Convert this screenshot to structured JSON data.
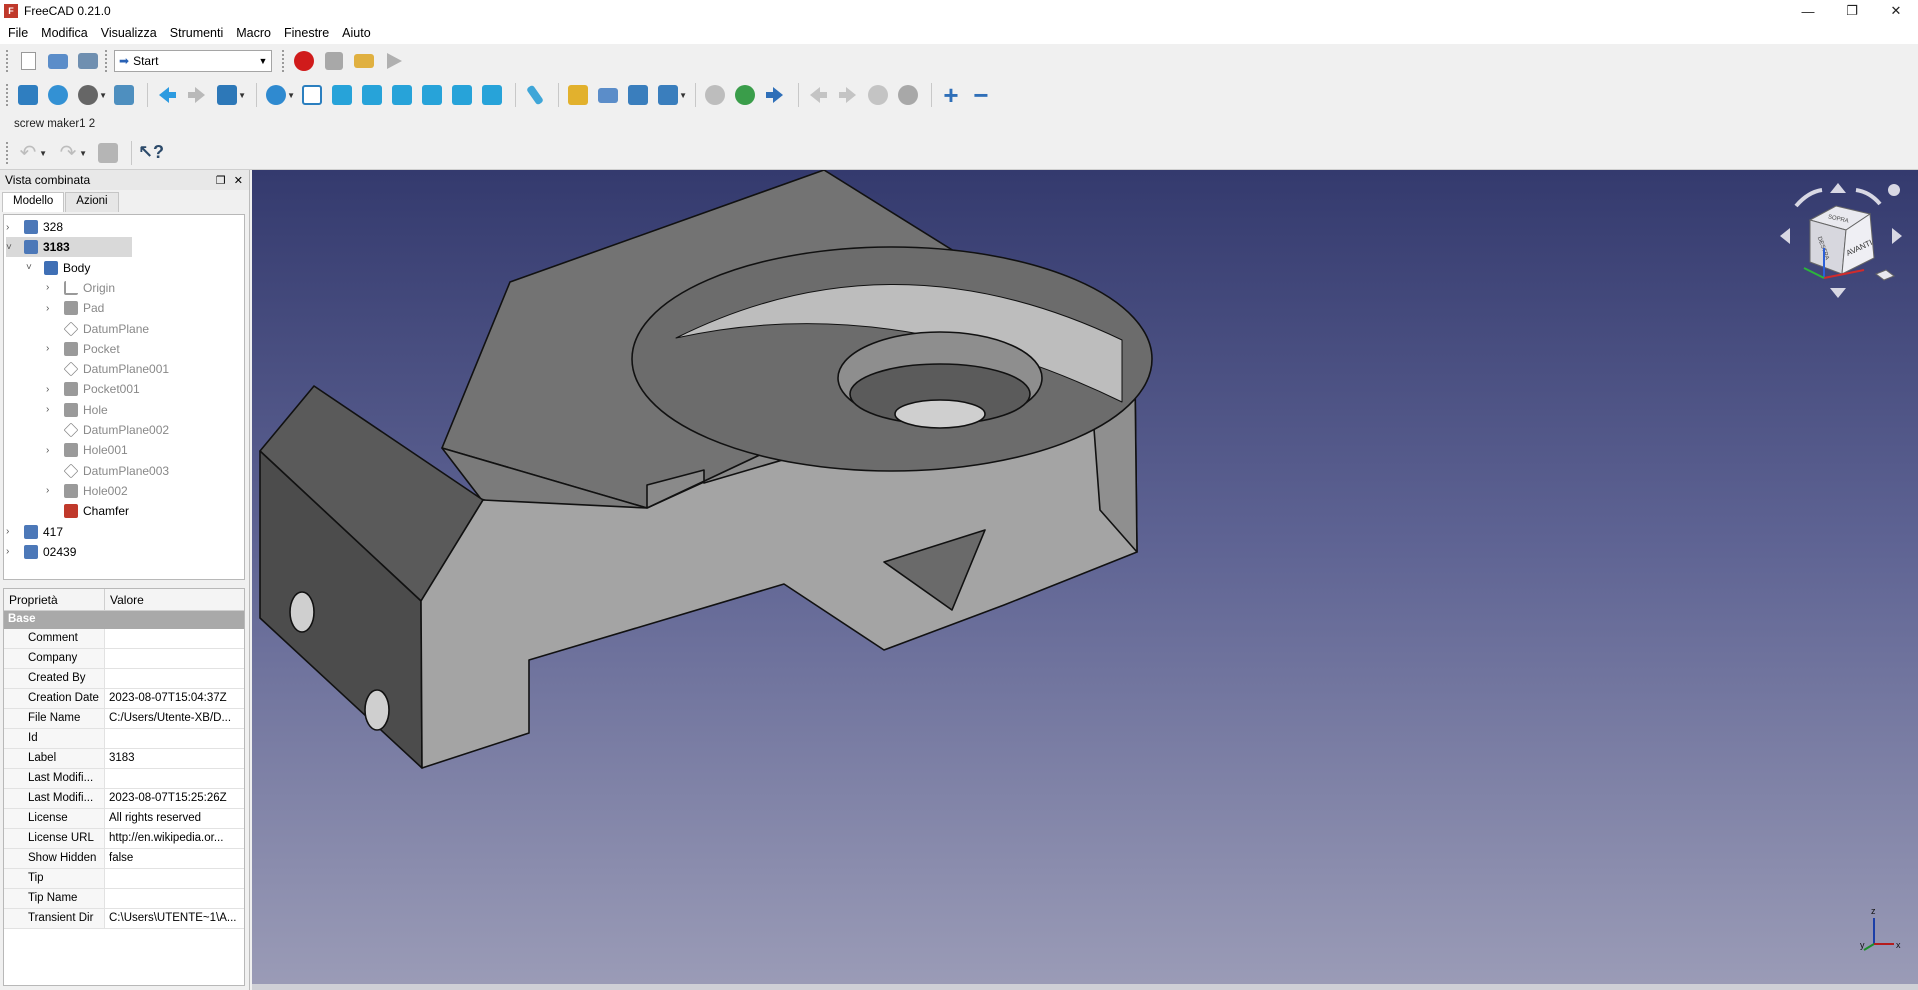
{
  "window": {
    "title": "FreeCAD 0.21.0"
  },
  "menu": [
    "File",
    "Modifica",
    "Visualizza",
    "Strumenti",
    "Macro",
    "Finestre",
    "Aiuto"
  ],
  "workbench": {
    "selected": "Start"
  },
  "document_label": "screw maker1 2",
  "combo_view": {
    "title": "Vista combinata",
    "tabs": [
      "Modello",
      "Azioni"
    ],
    "tree": [
      {
        "label": "328",
        "level": 0,
        "expanded": false,
        "icon": "part-icon"
      },
      {
        "label": "3183",
        "level": 0,
        "expanded": true,
        "selected": true,
        "icon": "part-icon"
      },
      {
        "label": "Body",
        "level": 1,
        "expanded": true,
        "icon": "body-icon"
      },
      {
        "label": "Origin",
        "level": 2,
        "expanded": false,
        "grey": true,
        "icon": "origin-icon"
      },
      {
        "label": "Pad",
        "level": 2,
        "expanded": false,
        "grey": true,
        "icon": "pad-icon"
      },
      {
        "label": "DatumPlane",
        "level": 2,
        "grey": true,
        "icon": "datum-plane-icon"
      },
      {
        "label": "Pocket",
        "level": 2,
        "expanded": false,
        "grey": true,
        "icon": "pocket-icon"
      },
      {
        "label": "DatumPlane001",
        "level": 2,
        "grey": true,
        "icon": "datum-plane-icon"
      },
      {
        "label": "Pocket001",
        "level": 2,
        "expanded": false,
        "grey": true,
        "icon": "pocket-icon"
      },
      {
        "label": "Hole",
        "level": 2,
        "expanded": false,
        "grey": true,
        "icon": "hole-icon"
      },
      {
        "label": "DatumPlane002",
        "level": 2,
        "grey": true,
        "icon": "datum-plane-icon"
      },
      {
        "label": "Hole001",
        "level": 2,
        "expanded": false,
        "grey": true,
        "icon": "hole-icon"
      },
      {
        "label": "DatumPlane003",
        "level": 2,
        "grey": true,
        "icon": "datum-plane-icon"
      },
      {
        "label": "Hole002",
        "level": 2,
        "expanded": false,
        "grey": true,
        "icon": "hole-icon"
      },
      {
        "label": "Chamfer",
        "level": 2,
        "icon": "chamfer-icon"
      },
      {
        "label": "417",
        "level": 0,
        "expanded": false,
        "icon": "part-icon"
      },
      {
        "label": "02439",
        "level": 0,
        "expanded": false,
        "icon": "part-icon"
      }
    ]
  },
  "properties": {
    "header": {
      "key": "Proprietà",
      "value": "Valore"
    },
    "group": "Base",
    "rows": [
      {
        "key": "Comment",
        "value": ""
      },
      {
        "key": "Company",
        "value": ""
      },
      {
        "key": "Created By",
        "value": ""
      },
      {
        "key": "Creation Date",
        "value": "2023-08-07T15:04:37Z"
      },
      {
        "key": "File Name",
        "value": "C:/Users/Utente-XB/D..."
      },
      {
        "key": "Id",
        "value": ""
      },
      {
        "key": "Label",
        "value": "3183"
      },
      {
        "key": "Last Modifi...",
        "value": ""
      },
      {
        "key": "Last Modifi...",
        "value": "2023-08-07T15:25:26Z"
      },
      {
        "key": "License",
        "value": "All rights reserved"
      },
      {
        "key": "License URL",
        "value": "http://en.wikipedia.or..."
      },
      {
        "key": "Show Hidden",
        "value": "false"
      },
      {
        "key": "Tip",
        "value": ""
      },
      {
        "key": "Tip Name",
        "value": ""
      },
      {
        "key": "Transient Dir",
        "value": "C:\\Users\\UTENTE~1\\A..."
      }
    ]
  },
  "navcube": {
    "faces": [
      "SOPRA",
      "DESTRA",
      "AVANTI"
    ]
  },
  "axis": {
    "labels": [
      "z",
      "x",
      "y"
    ]
  }
}
